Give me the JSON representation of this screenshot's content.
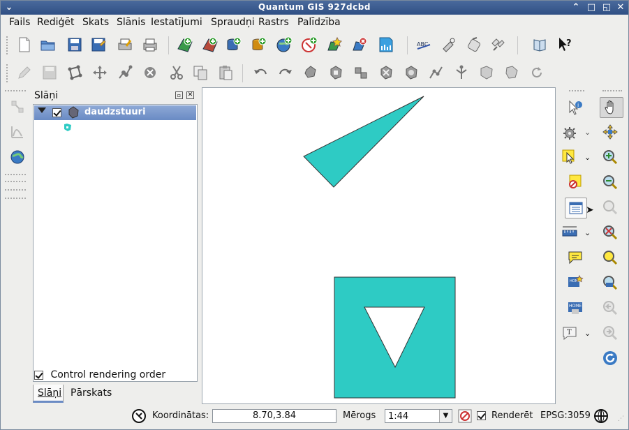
{
  "window": {
    "title": "Quantum GIS 927dcbd"
  },
  "menu": [
    "Fails",
    "Rediģēt",
    "Skats",
    "Slānis",
    "Iestatījumi",
    "Spraudņi",
    "Rastrs",
    "Palīdzība"
  ],
  "layers_panel": {
    "title": "Slāņi",
    "layer_name": "daudzstuuri",
    "control_rendering_label": "Control rendering order",
    "tabs": [
      "Slāņi",
      "Pārskats"
    ]
  },
  "statusbar": {
    "coordinates_label": "Koordinātas:",
    "coordinates_value": "8.70,3.84",
    "scale_label": "Mērogs",
    "scale_value": "1:44",
    "render_label": "Renderēt",
    "crs": "EPSG:3059"
  },
  "colors": {
    "feature_fill": "#2ecbc4",
    "selection": "#7a96cc"
  }
}
